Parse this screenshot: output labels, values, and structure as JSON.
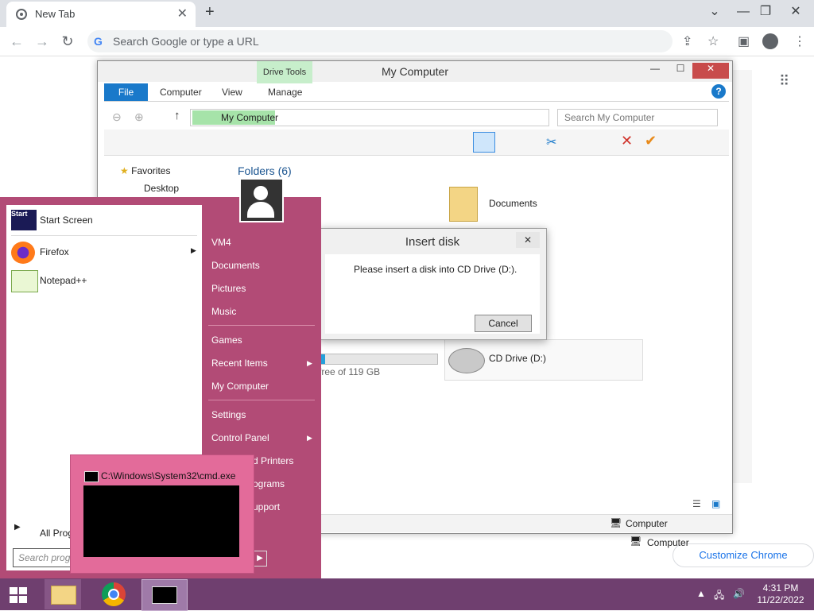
{
  "browser": {
    "tab_title": "New Tab",
    "tab_close": "✕",
    "new_tab": "+",
    "window_controls": [
      "⌄",
      "—",
      "❐",
      "✕"
    ],
    "omnibox_placeholder": "Search Google or type a URL",
    "omnibox_g": "G",
    "customize_label": "Customize Chrome"
  },
  "explorer": {
    "title": "My Computer",
    "drive_tools": "Drive Tools",
    "tabs": [
      "File",
      "Computer",
      "View",
      "Manage"
    ],
    "address": "My Computer",
    "search_placeholder": "Search My Computer",
    "nav": {
      "favorites": "Favorites",
      "desktop": "Desktop"
    },
    "folders_heading": "Folders (6)",
    "documents": "Documents",
    "cd_drive": "CD Drive (D:)",
    "free_text": "free of 119 GB",
    "disk_usage_fraction": 0.05,
    "status_left": "Computer",
    "status_right": "Computer"
  },
  "dialog": {
    "title": "Insert disk",
    "message": "Please insert a disk into CD Drive (D:).",
    "cancel": "Cancel",
    "close": "✕"
  },
  "start_menu": {
    "items": [
      {
        "label": "Start Screen",
        "icon_text": "Start"
      },
      {
        "label": "Firefox"
      },
      {
        "label": "Notepad++"
      }
    ],
    "all_programs": "All Prog",
    "search_placeholder": "Search prog",
    "right": {
      "vm4": "VM4",
      "documents": "Documents",
      "pictures": "Pictures",
      "music": "Music",
      "games": "Games",
      "recent_items": "Recent Items",
      "my_computer": "My Computer",
      "settings": "Settings",
      "control_panel": "Control Panel",
      "printers": "d Printers",
      "programs": "ograms",
      "support": "upport"
    }
  },
  "cmd_preview": {
    "title": "C:\\Windows\\System32\\cmd.exe"
  },
  "taskbar": {
    "time": "4:31 PM",
    "date": "11/22/2022"
  }
}
